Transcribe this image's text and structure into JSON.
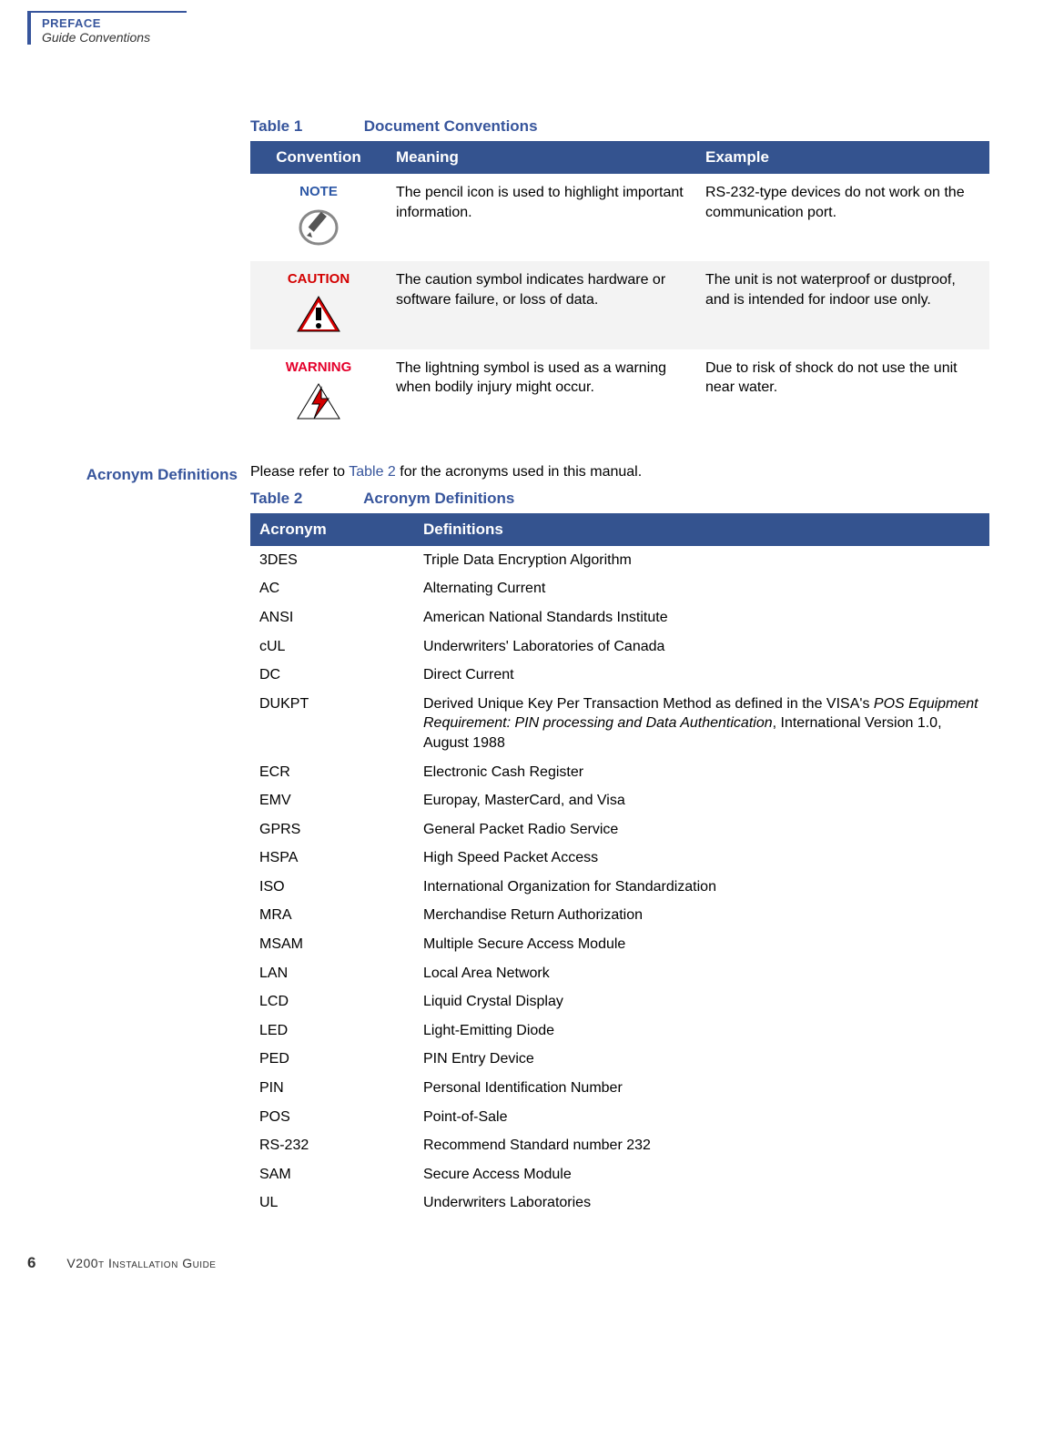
{
  "header": {
    "section": "PREFACE",
    "subsection": "Guide Conventions"
  },
  "table1": {
    "title_num": "Table 1",
    "title_text": "Document Conventions",
    "head": {
      "c1": "Convention",
      "c2": "Meaning",
      "c3": "Example"
    },
    "rows": [
      {
        "label": "NOTE",
        "meaning": "The pencil icon is used to highlight important information.",
        "example": "RS-232-type devices do not work on the communication port."
      },
      {
        "label": "CAUTION",
        "meaning": "The caution symbol indicates hardware or software failure, or loss of data.",
        "example": "The unit is not waterproof or dustproof, and is intended for indoor use only."
      },
      {
        "label": "WARNING",
        "meaning": "The lightning symbol is used as a warning when bodily injury might occur.",
        "example": "Due to risk of shock do not use the unit near water."
      }
    ]
  },
  "section2": {
    "label": "Acronym Definitions",
    "intro_pre": "Please refer to ",
    "intro_xref": "Table 2",
    "intro_post": " for the acronyms used in this manual."
  },
  "table2": {
    "title_num": "Table 2",
    "title_text": "Acronym Definitions",
    "head": {
      "c1": "Acronym",
      "c2": "Definitions"
    },
    "rows": [
      {
        "a": "3DES",
        "d": "Triple Data Encryption Algorithm"
      },
      {
        "a": "AC",
        "d": "Alternating Current"
      },
      {
        "a": "ANSI",
        "d": "American National Standards Institute"
      },
      {
        "a": "cUL",
        "d": "Underwriters' Laboratories of Canada"
      },
      {
        "a": "DC",
        "d": "Direct Current"
      },
      {
        "a": "DUKPT",
        "d_pre": "Derived Unique Key Per Transaction Method as defined in the VISA's ",
        "d_italic": "POS Equipment Requirement: PIN processing and Data Authentication",
        "d_post": ", International Version 1.0, August 1988"
      },
      {
        "a": "ECR",
        "d": "Electronic Cash Register"
      },
      {
        "a": "EMV",
        "d": "Europay, MasterCard, and Visa"
      },
      {
        "a": "GPRS",
        "d": "General Packet Radio Service"
      },
      {
        "a": "HSPA",
        "d": "High Speed Packet Access"
      },
      {
        "a": "ISO",
        "d": "International Organization for Standardization"
      },
      {
        "a": "MRA",
        "d": "Merchandise Return Authorization"
      },
      {
        "a": "MSAM",
        "d": "Multiple Secure Access Module"
      },
      {
        "a": "LAN",
        "d": "Local Area Network"
      },
      {
        "a": "LCD",
        "d": "Liquid Crystal Display"
      },
      {
        "a": "LED",
        "d": "Light-Emitting Diode"
      },
      {
        "a": "PED",
        "d": "PIN Entry Device"
      },
      {
        "a": "PIN",
        "d": "Personal Identification Number"
      },
      {
        "a": "POS",
        "d": "Point-of-Sale"
      },
      {
        "a": "RS-232",
        "d": "Recommend Standard number 232"
      },
      {
        "a": "SAM",
        "d": "Secure Access Module"
      },
      {
        "a": "UL",
        "d": "Underwriters Laboratories"
      }
    ]
  },
  "footer": {
    "page": "6",
    "title": "V200t Installation Guide"
  }
}
